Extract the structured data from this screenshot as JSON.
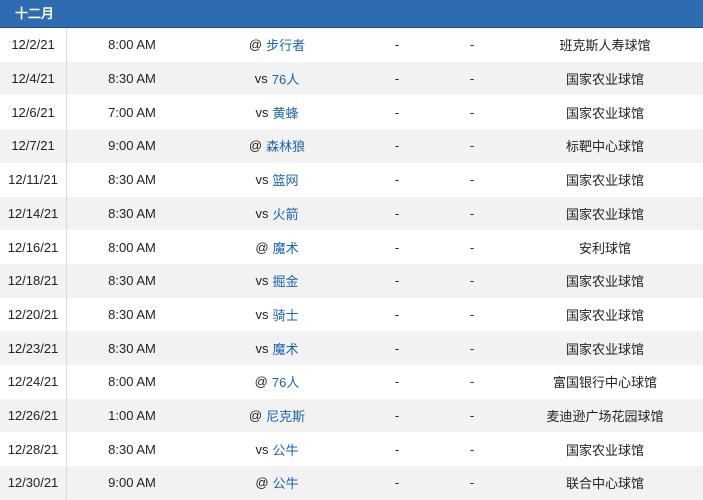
{
  "schedule": {
    "month": "十二月",
    "games": [
      {
        "date": "12/2/21",
        "time": "8:00 AM",
        "prefix": "@",
        "opponent": "步行者",
        "score1": "-",
        "score2": "-",
        "venue": "班克斯人寿球馆"
      },
      {
        "date": "12/4/21",
        "time": "8:30 AM",
        "prefix": "vs",
        "opponent": "76人",
        "score1": "-",
        "score2": "-",
        "venue": "国家农业球馆"
      },
      {
        "date": "12/6/21",
        "time": "7:00 AM",
        "prefix": "vs",
        "opponent": "黄蜂",
        "score1": "-",
        "score2": "-",
        "venue": "国家农业球馆"
      },
      {
        "date": "12/7/21",
        "time": "9:00 AM",
        "prefix": "@",
        "opponent": "森林狼",
        "score1": "-",
        "score2": "-",
        "venue": "标靶中心球馆"
      },
      {
        "date": "12/11/21",
        "time": "8:30 AM",
        "prefix": "vs",
        "opponent": "篮网",
        "score1": "-",
        "score2": "-",
        "venue": "国家农业球馆"
      },
      {
        "date": "12/14/21",
        "time": "8:30 AM",
        "prefix": "vs",
        "opponent": "火箭",
        "score1": "-",
        "score2": "-",
        "venue": "国家农业球馆"
      },
      {
        "date": "12/16/21",
        "time": "8:00 AM",
        "prefix": "@",
        "opponent": "魔术",
        "score1": "-",
        "score2": "-",
        "venue": "安利球馆"
      },
      {
        "date": "12/18/21",
        "time": "8:30 AM",
        "prefix": "vs",
        "opponent": "掘金",
        "score1": "-",
        "score2": "-",
        "venue": "国家农业球馆"
      },
      {
        "date": "12/20/21",
        "time": "8:30 AM",
        "prefix": "vs",
        "opponent": "骑士",
        "score1": "-",
        "score2": "-",
        "venue": "国家农业球馆"
      },
      {
        "date": "12/23/21",
        "time": "8:30 AM",
        "prefix": "vs",
        "opponent": "魔术",
        "score1": "-",
        "score2": "-",
        "venue": "国家农业球馆"
      },
      {
        "date": "12/24/21",
        "time": "8:00 AM",
        "prefix": "@",
        "opponent": "76人",
        "score1": "-",
        "score2": "-",
        "venue": "富国银行中心球馆"
      },
      {
        "date": "12/26/21",
        "time": "1:00 AM",
        "prefix": "@",
        "opponent": "尼克斯",
        "score1": "-",
        "score2": "-",
        "venue": "麦迪逊广场花园球馆"
      },
      {
        "date": "12/28/21",
        "time": "8:30 AM",
        "prefix": "vs",
        "opponent": "公牛",
        "score1": "-",
        "score2": "-",
        "venue": "国家农业球馆"
      },
      {
        "date": "12/30/21",
        "time": "9:00 AM",
        "prefix": "@",
        "opponent": "公牛",
        "score1": "-",
        "score2": "-",
        "venue": "联合中心球馆"
      }
    ]
  }
}
